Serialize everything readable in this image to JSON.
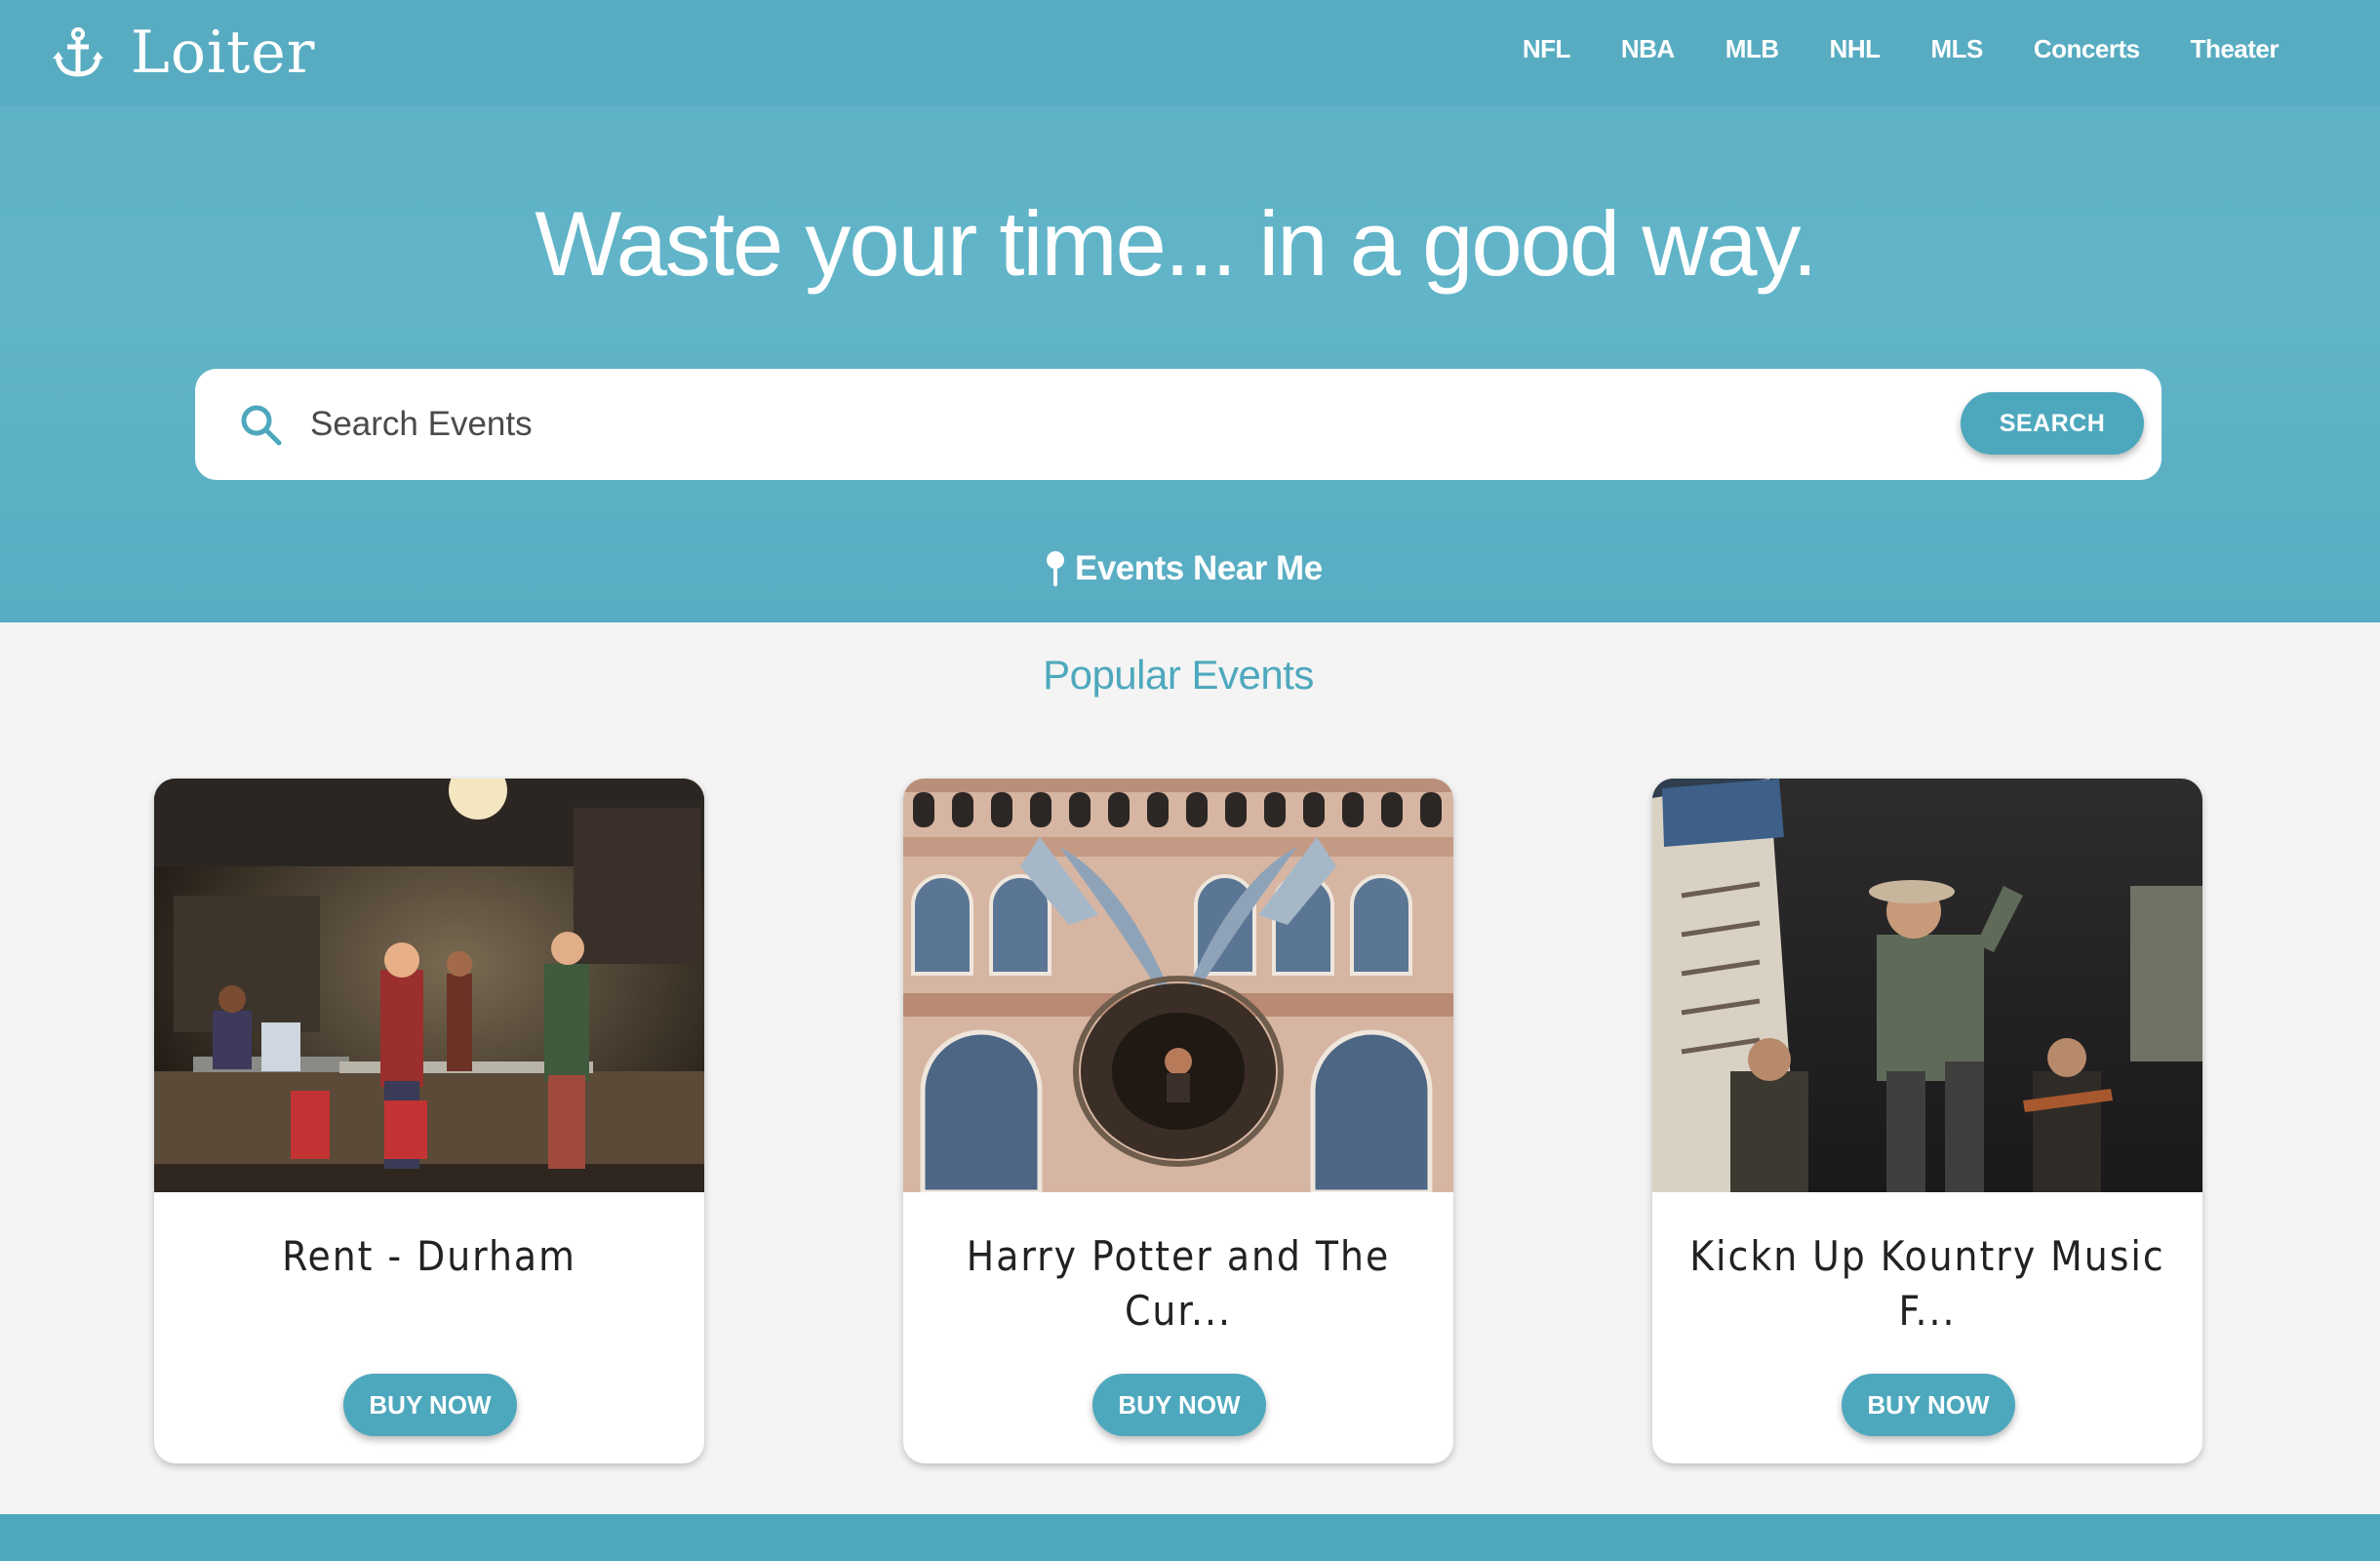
{
  "brand": {
    "name": "Loiter",
    "icon": "anchor-icon"
  },
  "nav": {
    "items": [
      {
        "label": "NFL"
      },
      {
        "label": "NBA"
      },
      {
        "label": "MLB"
      },
      {
        "label": "NHL"
      },
      {
        "label": "MLS"
      },
      {
        "label": "Concerts"
      },
      {
        "label": "Theater"
      }
    ]
  },
  "hero": {
    "headline": "Waste your time... in a good way.",
    "search": {
      "placeholder": "Search Events",
      "value": "",
      "button_label": "SEARCH",
      "icon": "search-icon"
    },
    "near_me": {
      "label": "Events Near Me",
      "icon": "map-pin-icon"
    }
  },
  "popular": {
    "title": "Popular Events",
    "events": [
      {
        "title": "Rent - Durham",
        "button_label": "BUY NOW"
      },
      {
        "title": "Harry Potter and The Cur...",
        "button_label": "BUY NOW"
      },
      {
        "title": "Kickn Up Kountry Music F...",
        "button_label": "BUY NOW"
      }
    ]
  },
  "colors": {
    "hero": "#5cafc4",
    "accent": "#4ea8bd",
    "page_background": "#f4f4f4",
    "text": "#222222"
  }
}
